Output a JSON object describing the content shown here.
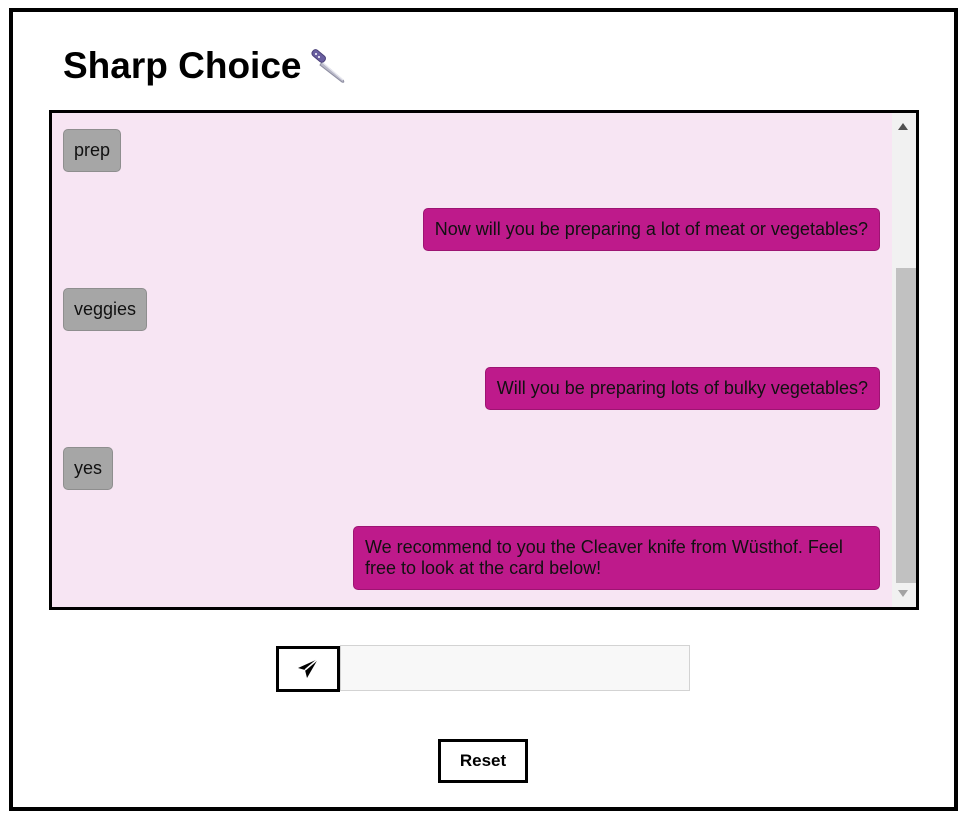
{
  "header": {
    "title": "Sharp Choice",
    "title_icon": "kitchen-knife-icon"
  },
  "chat": {
    "messages": [
      {
        "sender": "user",
        "text": "prep"
      },
      {
        "sender": "bot",
        "text": "Now will you be preparing a lot of meat or vegetables?"
      },
      {
        "sender": "user",
        "text": "veggies"
      },
      {
        "sender": "bot",
        "text": "Will you be preparing lots of bulky vegetables?"
      },
      {
        "sender": "user",
        "text": "yes"
      },
      {
        "sender": "bot",
        "text": "We recommend to you the Cleaver knife from Wüsthof. Feel free to look at the card below!"
      }
    ]
  },
  "composer": {
    "send_icon": "paper-plane-icon",
    "input_value": "",
    "input_placeholder": ""
  },
  "actions": {
    "reset_label": "Reset"
  },
  "colors": {
    "chat_background": "#f7e5f3",
    "bot_bubble": "#be1a8b",
    "user_bubble": "#a6a6a6"
  }
}
